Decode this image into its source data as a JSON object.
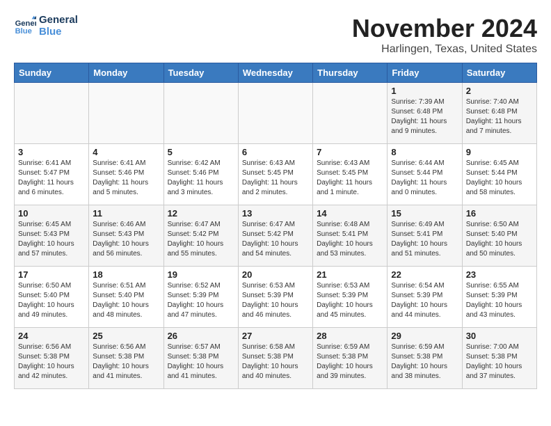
{
  "logo": {
    "line1": "General",
    "line2": "Blue"
  },
  "title": "November 2024",
  "location": "Harlingen, Texas, United States",
  "days_of_week": [
    "Sunday",
    "Monday",
    "Tuesday",
    "Wednesday",
    "Thursday",
    "Friday",
    "Saturday"
  ],
  "weeks": [
    [
      {
        "day": "",
        "info": ""
      },
      {
        "day": "",
        "info": ""
      },
      {
        "day": "",
        "info": ""
      },
      {
        "day": "",
        "info": ""
      },
      {
        "day": "",
        "info": ""
      },
      {
        "day": "1",
        "info": "Sunrise: 7:39 AM\nSunset: 6:48 PM\nDaylight: 11 hours\nand 9 minutes."
      },
      {
        "day": "2",
        "info": "Sunrise: 7:40 AM\nSunset: 6:48 PM\nDaylight: 11 hours\nand 7 minutes."
      }
    ],
    [
      {
        "day": "3",
        "info": "Sunrise: 6:41 AM\nSunset: 5:47 PM\nDaylight: 11 hours\nand 6 minutes."
      },
      {
        "day": "4",
        "info": "Sunrise: 6:41 AM\nSunset: 5:46 PM\nDaylight: 11 hours\nand 5 minutes."
      },
      {
        "day": "5",
        "info": "Sunrise: 6:42 AM\nSunset: 5:46 PM\nDaylight: 11 hours\nand 3 minutes."
      },
      {
        "day": "6",
        "info": "Sunrise: 6:43 AM\nSunset: 5:45 PM\nDaylight: 11 hours\nand 2 minutes."
      },
      {
        "day": "7",
        "info": "Sunrise: 6:43 AM\nSunset: 5:45 PM\nDaylight: 11 hours\nand 1 minute."
      },
      {
        "day": "8",
        "info": "Sunrise: 6:44 AM\nSunset: 5:44 PM\nDaylight: 11 hours\nand 0 minutes."
      },
      {
        "day": "9",
        "info": "Sunrise: 6:45 AM\nSunset: 5:44 PM\nDaylight: 10 hours\nand 58 minutes."
      }
    ],
    [
      {
        "day": "10",
        "info": "Sunrise: 6:45 AM\nSunset: 5:43 PM\nDaylight: 10 hours\nand 57 minutes."
      },
      {
        "day": "11",
        "info": "Sunrise: 6:46 AM\nSunset: 5:43 PM\nDaylight: 10 hours\nand 56 minutes."
      },
      {
        "day": "12",
        "info": "Sunrise: 6:47 AM\nSunset: 5:42 PM\nDaylight: 10 hours\nand 55 minutes."
      },
      {
        "day": "13",
        "info": "Sunrise: 6:47 AM\nSunset: 5:42 PM\nDaylight: 10 hours\nand 54 minutes."
      },
      {
        "day": "14",
        "info": "Sunrise: 6:48 AM\nSunset: 5:41 PM\nDaylight: 10 hours\nand 53 minutes."
      },
      {
        "day": "15",
        "info": "Sunrise: 6:49 AM\nSunset: 5:41 PM\nDaylight: 10 hours\nand 51 minutes."
      },
      {
        "day": "16",
        "info": "Sunrise: 6:50 AM\nSunset: 5:40 PM\nDaylight: 10 hours\nand 50 minutes."
      }
    ],
    [
      {
        "day": "17",
        "info": "Sunrise: 6:50 AM\nSunset: 5:40 PM\nDaylight: 10 hours\nand 49 minutes."
      },
      {
        "day": "18",
        "info": "Sunrise: 6:51 AM\nSunset: 5:40 PM\nDaylight: 10 hours\nand 48 minutes."
      },
      {
        "day": "19",
        "info": "Sunrise: 6:52 AM\nSunset: 5:39 PM\nDaylight: 10 hours\nand 47 minutes."
      },
      {
        "day": "20",
        "info": "Sunrise: 6:53 AM\nSunset: 5:39 PM\nDaylight: 10 hours\nand 46 minutes."
      },
      {
        "day": "21",
        "info": "Sunrise: 6:53 AM\nSunset: 5:39 PM\nDaylight: 10 hours\nand 45 minutes."
      },
      {
        "day": "22",
        "info": "Sunrise: 6:54 AM\nSunset: 5:39 PM\nDaylight: 10 hours\nand 44 minutes."
      },
      {
        "day": "23",
        "info": "Sunrise: 6:55 AM\nSunset: 5:39 PM\nDaylight: 10 hours\nand 43 minutes."
      }
    ],
    [
      {
        "day": "24",
        "info": "Sunrise: 6:56 AM\nSunset: 5:38 PM\nDaylight: 10 hours\nand 42 minutes."
      },
      {
        "day": "25",
        "info": "Sunrise: 6:56 AM\nSunset: 5:38 PM\nDaylight: 10 hours\nand 41 minutes."
      },
      {
        "day": "26",
        "info": "Sunrise: 6:57 AM\nSunset: 5:38 PM\nDaylight: 10 hours\nand 41 minutes."
      },
      {
        "day": "27",
        "info": "Sunrise: 6:58 AM\nSunset: 5:38 PM\nDaylight: 10 hours\nand 40 minutes."
      },
      {
        "day": "28",
        "info": "Sunrise: 6:59 AM\nSunset: 5:38 PM\nDaylight: 10 hours\nand 39 minutes."
      },
      {
        "day": "29",
        "info": "Sunrise: 6:59 AM\nSunset: 5:38 PM\nDaylight: 10 hours\nand 38 minutes."
      },
      {
        "day": "30",
        "info": "Sunrise: 7:00 AM\nSunset: 5:38 PM\nDaylight: 10 hours\nand 37 minutes."
      }
    ]
  ]
}
